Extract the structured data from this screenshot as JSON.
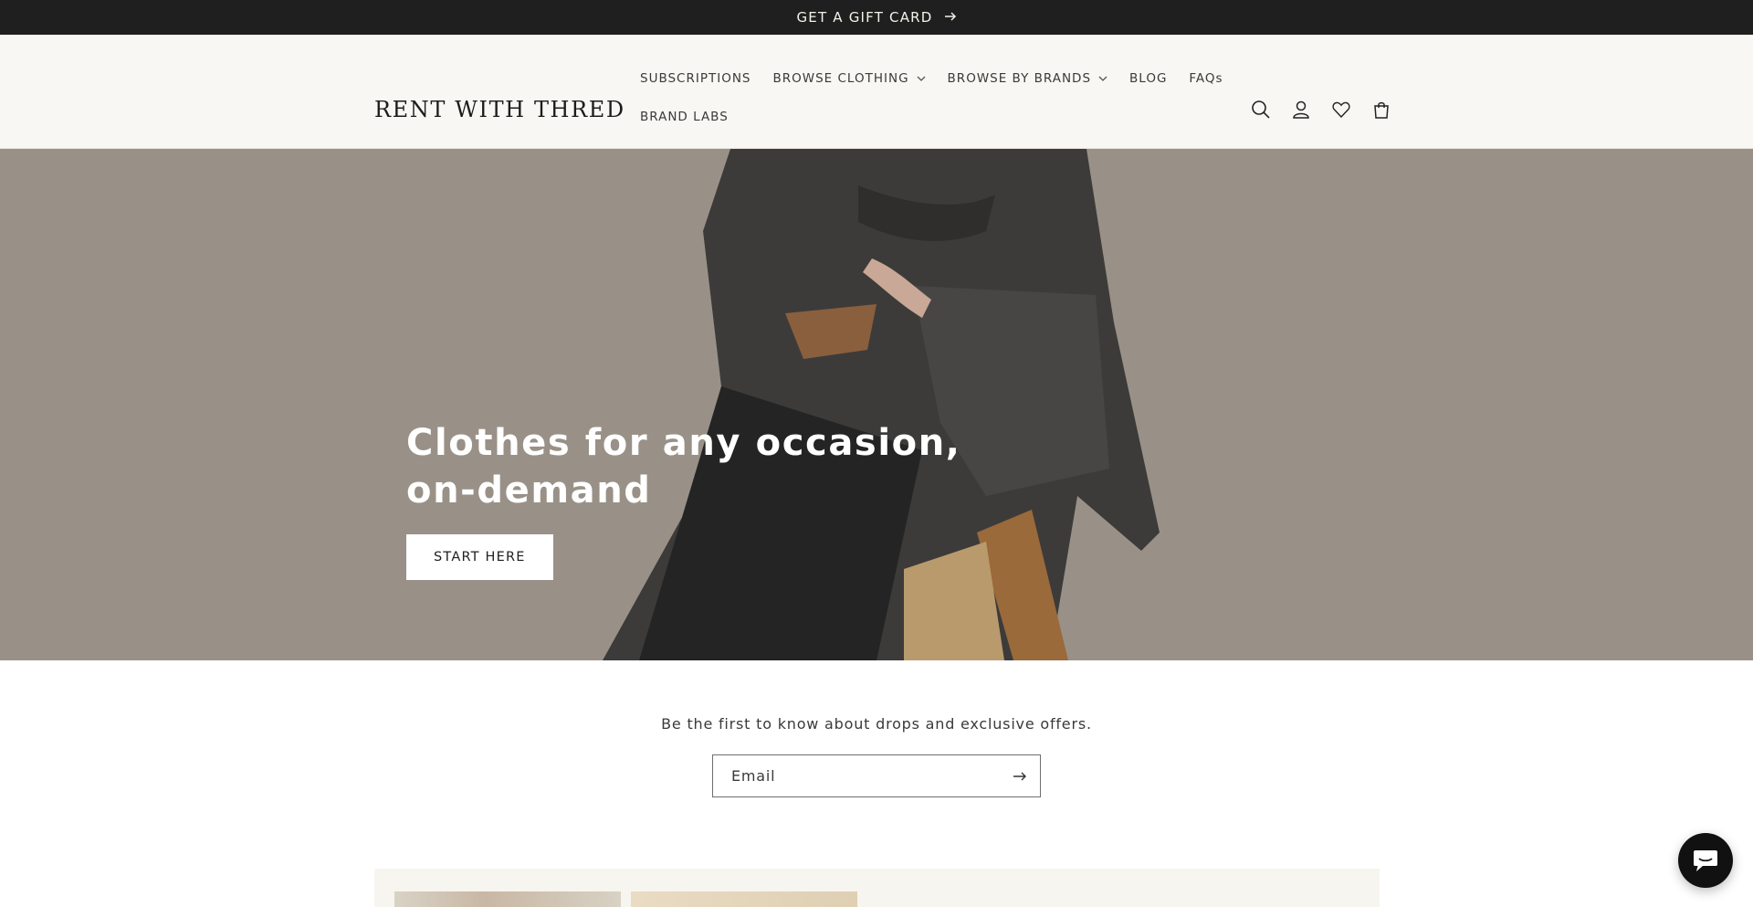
{
  "announcement": {
    "text": "GET A GIFT CARD",
    "icon": "arrow-right-icon"
  },
  "header": {
    "logo": "RENT WITH THRED",
    "nav": [
      {
        "label": "SUBSCRIPTIONS",
        "has_dropdown": false
      },
      {
        "label": "BROWSE CLOTHING",
        "has_dropdown": true
      },
      {
        "label": "BROWSE BY BRANDS",
        "has_dropdown": true
      },
      {
        "label": "BLOG",
        "has_dropdown": false
      },
      {
        "label": "FAQs",
        "has_dropdown": false
      },
      {
        "label": "BRAND LABS",
        "has_dropdown": false
      }
    ],
    "icons": [
      "search-icon",
      "account-icon",
      "wishlist-heart-icon",
      "cart-icon"
    ]
  },
  "hero": {
    "title": "Clothes for any occasion, on-demand",
    "button_label": "START HERE"
  },
  "newsletter": {
    "text": "Be the first to know about drops and exclusive offers.",
    "email_placeholder": "Email",
    "submit_icon": "arrow-right-icon"
  },
  "chat": {
    "icon": "chat-bubble-icon"
  },
  "colors": {
    "announcement_bg": "#1f1f1f",
    "header_bg": "#f9f7f3",
    "hero_bg": "#8f877d",
    "button_bg": "#ffffff",
    "chat_bg": "#111111"
  }
}
